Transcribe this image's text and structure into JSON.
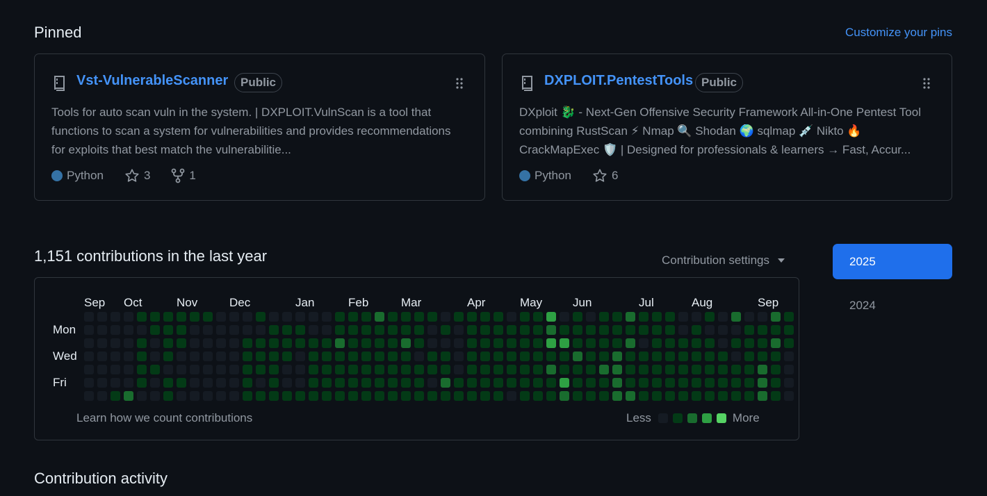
{
  "pinned": {
    "title": "Pinned",
    "customize_label": "Customize your pins",
    "cards": [
      {
        "name": "Vst-VulnerableScanner",
        "visibility": "Public",
        "description": "Tools for auto scan vuln in the system. | DXPLOIT.VulnScan is a tool that functions to scan a system for vulnerabilities and provides recommendations for exploits that best match the vulnerabilitie...",
        "language": "Python",
        "language_color": "#3572a5",
        "stars": "3",
        "forks": "1"
      },
      {
        "name": "DXPLOIT.PentestTools",
        "visibility": "Public",
        "description": "DXploit 🐉 - Next-Gen Offensive Security Framework All-in-One Pentest Tool combining RustScan ⚡ Nmap 🔍 Shodan 🌍 sqlmap 💉 Nikto 🔥 CrackMapExec 🛡️ | Designed for professionals & learners → Fast, Accur...",
        "language": "Python",
        "language_color": "#3572a5",
        "stars": "6"
      }
    ]
  },
  "contributions": {
    "title": "1,151 contributions in the last year",
    "settings_label": "Contribution settings",
    "months": [
      "Sep",
      "Oct",
      "Nov",
      "Dec",
      "Jan",
      "Feb",
      "Mar",
      "Apr",
      "May",
      "Jun",
      "Jul",
      "Aug",
      "Sep"
    ],
    "days": [
      "Mon",
      "Wed",
      "Fri"
    ],
    "learn_label": "Learn how we count contributions",
    "legend_less": "Less",
    "legend_more": "More",
    "level_colors": [
      "#151b23",
      "#033a16",
      "#196c2e",
      "#2ea043",
      "#56d364"
    ],
    "grid": [
      [
        0,
        0,
        0,
        0,
        0,
        0,
        0
      ],
      [
        0,
        0,
        0,
        0,
        0,
        0,
        0
      ],
      [
        0,
        0,
        0,
        0,
        0,
        0,
        1
      ],
      [
        0,
        0,
        0,
        0,
        0,
        0,
        2
      ],
      [
        1,
        0,
        1,
        1,
        1,
        1,
        0
      ],
      [
        1,
        1,
        0,
        0,
        1,
        0,
        0
      ],
      [
        1,
        1,
        1,
        1,
        0,
        1,
        1
      ],
      [
        1,
        1,
        1,
        0,
        0,
        1,
        0
      ],
      [
        1,
        0,
        0,
        0,
        0,
        0,
        0
      ],
      [
        1,
        0,
        0,
        0,
        0,
        0,
        0
      ],
      [
        0,
        0,
        0,
        0,
        0,
        0,
        0
      ],
      [
        0,
        0,
        0,
        0,
        0,
        0,
        0
      ],
      [
        0,
        0,
        1,
        1,
        1,
        1,
        1
      ],
      [
        1,
        0,
        1,
        1,
        1,
        0,
        1
      ],
      [
        0,
        1,
        1,
        1,
        1,
        1,
        1
      ],
      [
        0,
        1,
        1,
        1,
        0,
        0,
        1
      ],
      [
        0,
        1,
        1,
        0,
        0,
        0,
        1
      ],
      [
        0,
        0,
        1,
        1,
        1,
        1,
        1
      ],
      [
        0,
        0,
        1,
        1,
        1,
        1,
        1
      ],
      [
        1,
        1,
        2,
        1,
        1,
        1,
        1
      ],
      [
        1,
        1,
        1,
        1,
        1,
        1,
        1
      ],
      [
        1,
        1,
        1,
        1,
        1,
        1,
        1
      ],
      [
        2,
        1,
        1,
        1,
        1,
        1,
        1
      ],
      [
        1,
        1,
        1,
        1,
        1,
        1,
        1
      ],
      [
        1,
        1,
        2,
        1,
        1,
        1,
        1
      ],
      [
        1,
        1,
        1,
        0,
        1,
        1,
        1
      ],
      [
        1,
        0,
        0,
        1,
        1,
        0,
        1
      ],
      [
        0,
        1,
        0,
        1,
        1,
        2,
        1
      ],
      [
        1,
        0,
        0,
        0,
        0,
        1,
        1
      ],
      [
        1,
        1,
        1,
        1,
        1,
        1,
        1
      ],
      [
        1,
        1,
        1,
        1,
        1,
        1,
        1
      ],
      [
        1,
        1,
        1,
        1,
        1,
        1,
        1
      ],
      [
        0,
        1,
        1,
        1,
        1,
        1,
        0
      ],
      [
        1,
        1,
        1,
        1,
        1,
        1,
        1
      ],
      [
        1,
        1,
        1,
        1,
        1,
        1,
        1
      ],
      [
        3,
        2,
        3,
        1,
        2,
        1,
        1
      ],
      [
        0,
        1,
        3,
        1,
        1,
        3,
        2
      ],
      [
        1,
        1,
        1,
        2,
        1,
        1,
        1
      ],
      [
        0,
        1,
        1,
        1,
        1,
        1,
        1
      ],
      [
        1,
        1,
        1,
        1,
        2,
        1,
        1
      ],
      [
        1,
        1,
        1,
        2,
        2,
        2,
        2
      ],
      [
        2,
        1,
        2,
        1,
        1,
        1,
        2
      ],
      [
        1,
        1,
        0,
        1,
        1,
        1,
        1
      ],
      [
        1,
        1,
        1,
        1,
        1,
        1,
        1
      ],
      [
        1,
        1,
        1,
        1,
        1,
        1,
        1
      ],
      [
        0,
        0,
        1,
        1,
        1,
        1,
        1
      ],
      [
        0,
        1,
        1,
        1,
        1,
        1,
        1
      ],
      [
        1,
        0,
        1,
        1,
        1,
        1,
        1
      ],
      [
        0,
        0,
        0,
        1,
        1,
        1,
        1
      ],
      [
        2,
        0,
        1,
        0,
        1,
        1,
        1
      ],
      [
        0,
        1,
        1,
        1,
        1,
        1,
        1
      ],
      [
        0,
        1,
        1,
        1,
        2,
        2,
        2
      ],
      [
        2,
        1,
        2,
        1,
        1,
        1,
        1
      ],
      [
        1,
        1,
        1,
        0,
        0,
        0,
        0
      ]
    ]
  },
  "years": {
    "active": "2025",
    "other": "2024"
  },
  "activity": {
    "title": "Contribution activity"
  }
}
